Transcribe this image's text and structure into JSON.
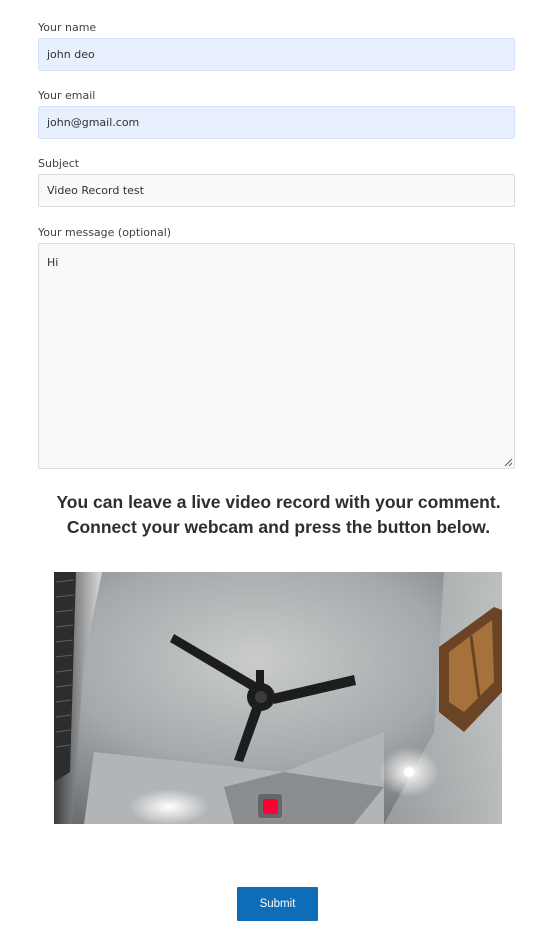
{
  "form": {
    "name": {
      "label": "Your name",
      "value": "john deo"
    },
    "email": {
      "label": "Your email",
      "value": "john@gmail.com"
    },
    "subject": {
      "label": "Subject",
      "value": "Video Record test"
    },
    "message": {
      "label": "Your message (optional)",
      "value": "Hi"
    }
  },
  "video_prompt": {
    "line1": "You can leave a live video record with your comment.",
    "line2": "Connect your webcam and press the button below."
  },
  "recorder": {
    "state": "recording",
    "button_icon": "stop-record-icon",
    "button_color": "#ff0033"
  },
  "submit_label": "Submit",
  "colors": {
    "autofill_bg": "#e8f0fe",
    "field_bg": "#f9f9f9",
    "submit_bg": "#0f6cb6"
  }
}
